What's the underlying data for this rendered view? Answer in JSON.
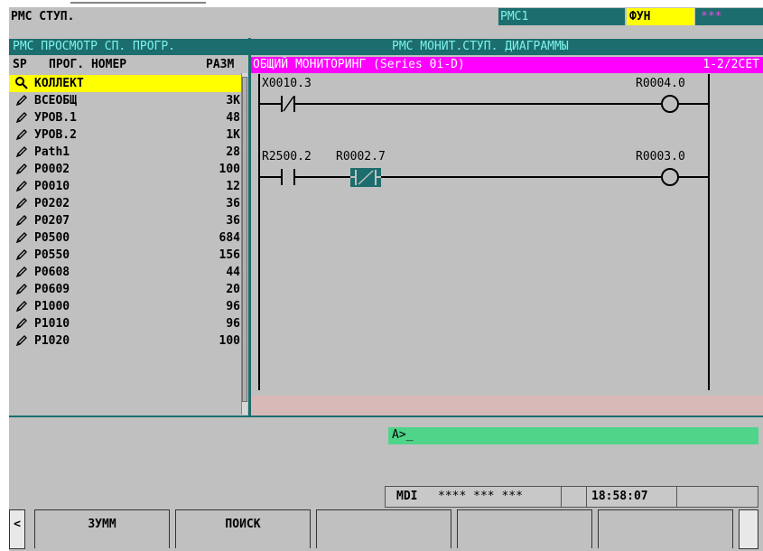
{
  "top": {
    "title": "РМС СТУП.",
    "path": "РМС1",
    "mode": "ФУН",
    "stars": "***"
  },
  "program_list": {
    "title": "РМС ПРОСМОТР СП. ПРОГР.",
    "columns": {
      "sp": "SP",
      "name": "ПРОГ. НОМЕР",
      "size": "РАЗМ"
    },
    "items": [
      {
        "name": "КОЛЛЕКТ",
        "size": "",
        "icon": "magnifier-icon",
        "selected": true
      },
      {
        "name": "ВСЕОБЩ",
        "size": "3K",
        "icon": "pencil-icon"
      },
      {
        "name": "УРОВ.1",
        "size": "48",
        "icon": "pencil-icon"
      },
      {
        "name": "УРОВ.2",
        "size": "1K",
        "icon": "pencil-icon"
      },
      {
        "name": "Path1",
        "size": "28",
        "icon": "pencil-icon"
      },
      {
        "name": "P0002",
        "size": "100",
        "icon": "pencil-icon"
      },
      {
        "name": "P0010",
        "size": "12",
        "icon": "pencil-icon"
      },
      {
        "name": "P0202",
        "size": "36",
        "icon": "pencil-icon"
      },
      {
        "name": "P0207",
        "size": "36",
        "icon": "pencil-icon"
      },
      {
        "name": "P0500",
        "size": "684",
        "icon": "pencil-icon"
      },
      {
        "name": "P0550",
        "size": "156",
        "icon": "pencil-icon"
      },
      {
        "name": "P0608",
        "size": "44",
        "icon": "pencil-icon"
      },
      {
        "name": "P0609",
        "size": "20",
        "icon": "pencil-icon"
      },
      {
        "name": "P1000",
        "size": "96",
        "icon": "pencil-icon"
      },
      {
        "name": "P1010",
        "size": "96",
        "icon": "pencil-icon"
      },
      {
        "name": "P1020",
        "size": "100",
        "icon": "pencil-icon"
      }
    ]
  },
  "ladder": {
    "title": "РМС МОНИТ.СТУП. ДИАГРАММЫ",
    "subtitle": "ОБЩИЙ МОНИТОРИНГ (Series 0i-D)",
    "net_info": "1-2/2СЕТ",
    "rungs": [
      {
        "contacts": [
          "X0010.3"
        ],
        "coil": "R0004.0"
      },
      {
        "contacts": [
          "R2500.2",
          "R0002.7"
        ],
        "coil": "R0003.0"
      }
    ]
  },
  "input": {
    "prompt": "A>_"
  },
  "status": {
    "mode": "MDI",
    "stars": "**** *** ***",
    "time": "18:58:07"
  },
  "softkeys": {
    "left_arrow": "<",
    "zoom": "ЗУММ",
    "search": "ПОИСК",
    "right": ""
  },
  "colors": {
    "title_bar": "#1c6d6d",
    "title_text": "#7df2ea",
    "subtitle_bar": "#ff00ff",
    "selection": "#ffff00",
    "mode_bg": "#ffff00"
  }
}
